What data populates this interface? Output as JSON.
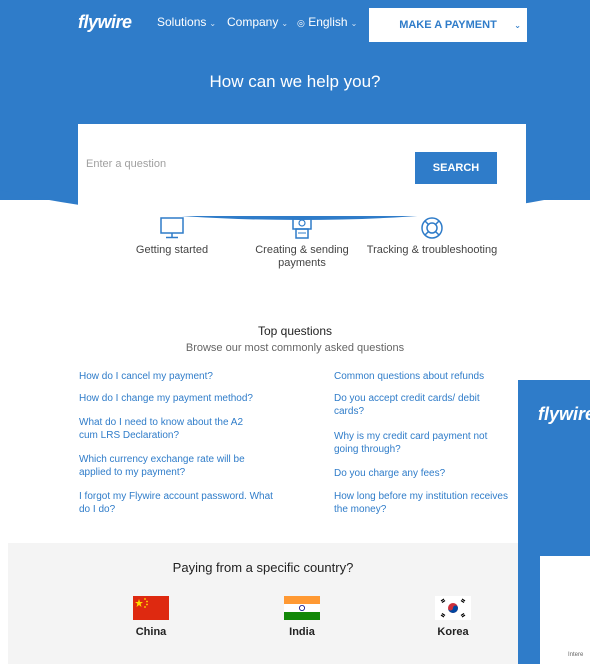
{
  "nav": {
    "logo": "flywire",
    "items": [
      {
        "label": "Solutions"
      },
      {
        "label": "Company"
      },
      {
        "label": "English"
      }
    ],
    "cta": "MAKE A PAYMENT"
  },
  "hero": {
    "title": "How can we help you?"
  },
  "search": {
    "placeholder": "Enter a question",
    "button": "SEARCH"
  },
  "categories": [
    {
      "label": "Getting started",
      "icon": "monitor-icon"
    },
    {
      "label": "Creating & sending payments",
      "icon": "payment-icon"
    },
    {
      "label": "Tracking & troubleshooting",
      "icon": "lifebuoy-icon"
    }
  ],
  "top": {
    "title": "Top questions",
    "subtitle": "Browse our most commonly asked questions"
  },
  "questions_left": [
    "How do I cancel my payment?",
    "How do I change my payment method?",
    "What do I need to know about the A2 cum LRS Declaration?",
    "Which currency exchange rate will be applied to my payment?",
    "I forgot my Flywire account password. What do I do?"
  ],
  "questions_right": [
    "Common questions about refunds",
    "Do you accept credit cards/ debit cards?",
    "Why is my credit card payment not going through?",
    "Do you charge any fees?",
    "How long before my institution receives the money?"
  ],
  "countries": {
    "title": "Paying from a specific country?",
    "items": [
      {
        "name": "China"
      },
      {
        "name": "India"
      },
      {
        "name": "Korea"
      }
    ]
  },
  "fragment": {
    "logo": "flywire",
    "small_text": "Intere"
  },
  "colors": {
    "brand": "#2f7cc9"
  }
}
